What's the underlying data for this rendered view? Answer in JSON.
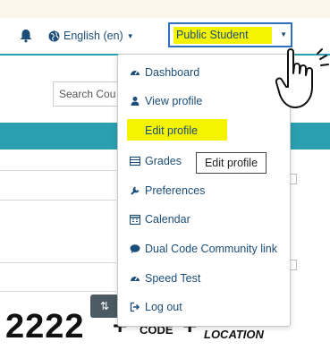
{
  "navbar": {
    "notifications_icon": "bell-icon",
    "language_label": "English (en)",
    "language_icon": "globe-icon",
    "user_name": "Public Student",
    "accent": "#2a9fb0",
    "highlight": "#f4f300"
  },
  "search": {
    "placeholder": "Search Cou"
  },
  "user_menu": {
    "items": [
      {
        "label": "Dashboard",
        "icon": "dashboard-icon"
      },
      {
        "label": "View profile",
        "icon": "user-icon"
      },
      {
        "label": "Edit profile",
        "icon": "gear-icon"
      },
      {
        "label": "Grades",
        "icon": "grades-table-icon"
      },
      {
        "label": "Preferences",
        "icon": "wrench-icon"
      },
      {
        "label": "Calendar",
        "icon": "calendar-icon"
      },
      {
        "label": "Dual Code Community link",
        "icon": "chat-icon"
      },
      {
        "label": "Speed Test",
        "icon": "dashboard-icon"
      },
      {
        "label": "Log out",
        "icon": "logout-icon"
      }
    ]
  },
  "tooltip": {
    "text": "Edit profile"
  },
  "bottom": {
    "number": "2222",
    "plus": "+",
    "code": "CODE",
    "location": "LOCATION"
  }
}
